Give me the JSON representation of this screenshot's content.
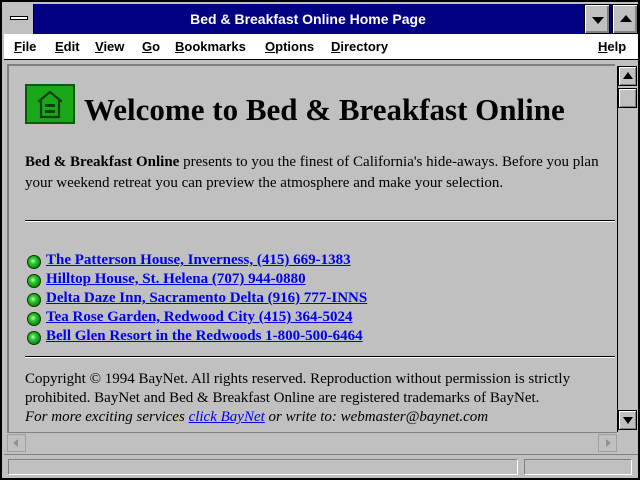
{
  "window": {
    "title": "Bed & Breakfast Online Home Page"
  },
  "menu": {
    "items": [
      {
        "name": "file",
        "label": "File",
        "mnemonic": "F",
        "rest": "ile"
      },
      {
        "name": "edit",
        "label": "Edit",
        "mnemonic": "E",
        "rest": "dit"
      },
      {
        "name": "view",
        "label": "View",
        "mnemonic": "V",
        "rest": "iew"
      },
      {
        "name": "go",
        "label": "Go",
        "mnemonic": "G",
        "rest": "o"
      },
      {
        "name": "bookmarks",
        "label": "Bookmarks",
        "mnemonic": "B",
        "rest": "ookmarks"
      },
      {
        "name": "options",
        "label": "Options",
        "mnemonic": "O",
        "rest": "ptions"
      },
      {
        "name": "directory",
        "label": "Directory",
        "mnemonic": "D",
        "rest": "irectory"
      },
      {
        "name": "help",
        "label": "Help",
        "mnemonic": "H",
        "rest": "elp"
      }
    ]
  },
  "page": {
    "heading": "Welcome to Bed & Breakfast Online",
    "intro_bold": "Bed & Breakfast Online",
    "intro_rest": " presents to you the finest of California's hide-aways. Before you plan your weekend retreat you can preview the atmosphere and make your selection.",
    "links": [
      " The Patterson House, Inverness, (415) 669-1383",
      " Hilltop House, St. Helena (707) 944-0880",
      " Delta Daze Inn, Sacramento Delta (916) 777-INNS",
      " Tea Rose Garden, Redwood City (415) 364-5024",
      " Bell Glen Resort in the Redwoods 1-800-500-6464 "
    ],
    "copyright": "Copyright © 1994 BayNet. All rights reserved. Reproduction without permission is strictly prohibited. BayNet and Bed & Breakfast Online are registered trademarks of BayNet.",
    "more_prefix": "For more exciting services ",
    "more_link": "click BayNet",
    "more_suffix": " or write to: webmaster@baynet.com"
  },
  "icons": {
    "logo": "equal-housing-house-icon",
    "bullet": "green-ball-bullet-icon"
  },
  "colors": {
    "title_bar": "#000080",
    "link": "#0000ee",
    "background": "#c0c0c0",
    "logo_green": "#1aa81a"
  }
}
